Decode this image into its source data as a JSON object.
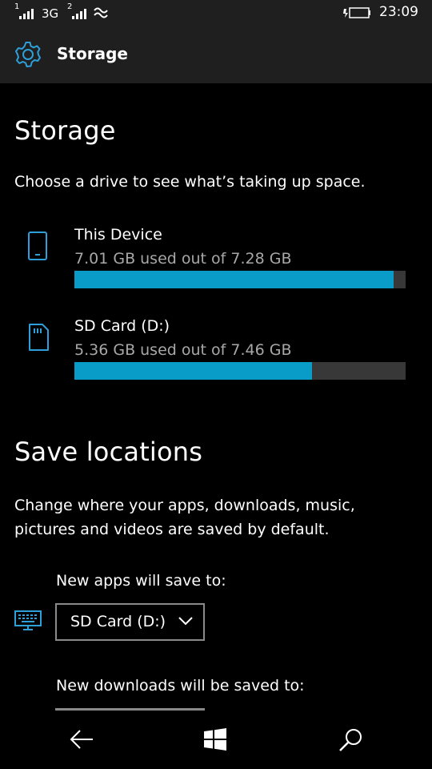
{
  "status_bar": {
    "sim1": "1",
    "sim2": "2",
    "network": "3G",
    "time": "23:09"
  },
  "header": {
    "icon": "gear-icon",
    "title": "Storage"
  },
  "storage": {
    "heading": "Storage",
    "description": "Choose a drive to see what’s taking up space.",
    "drives": [
      {
        "icon": "phone-icon",
        "name": "This Device",
        "usage_text": "7.01 GB used out of 7.28 GB",
        "used_fraction": 0.963
      },
      {
        "icon": "sd-card-icon",
        "name": "SD Card (D:)",
        "usage_text": "5.36 GB used out of 7.46 GB",
        "used_fraction": 0.718
      }
    ]
  },
  "save_locations": {
    "heading": "Save locations",
    "description_line1": "Change where your apps, downloads, music,",
    "description_line2": "pictures and videos are saved by default.",
    "new_apps_label": "New apps will save to:",
    "new_apps_value": "SD Card (D:)",
    "new_downloads_label": "New downloads will be saved to:"
  },
  "colors": {
    "accent": "#0a9cc8",
    "bar_track": "#383838",
    "chrome": "#1f1f1f"
  }
}
